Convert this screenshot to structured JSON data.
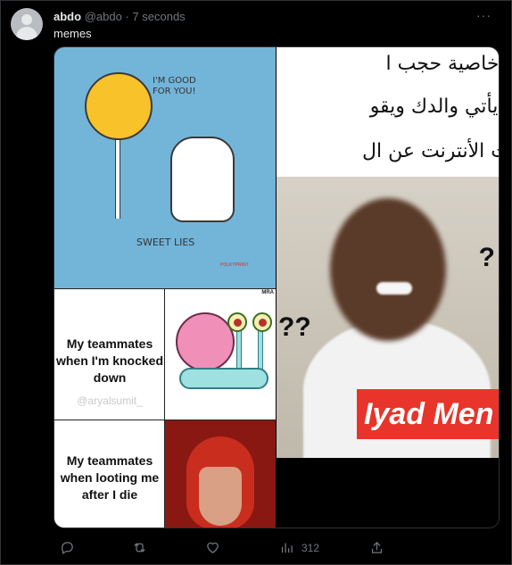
{
  "tweet": {
    "author_name": "abdo",
    "author_handle": "@abdo",
    "separator": "·",
    "time": "7 seconds",
    "more_label": "···",
    "text": "memes"
  },
  "meme_left": {
    "speech": "I'M GOOD FOR YOU!",
    "caption": "SWEET LIES",
    "credit": "POLKYPRINT",
    "panel1_caption": "My teammates when I'm knocked down",
    "panel1_watermark": "@aryalsumit_",
    "panel2_caption": "My teammates when looting me after I die",
    "corner_mark": "MRA"
  },
  "meme_right": {
    "line1": "تفعل خاصية حجب ا",
    "line2": "ية ثم يأتي والدك ويقو",
    "line3": "توقفت الأنترنت عن ال",
    "question_small": "?",
    "question_big": "??",
    "banner": "Iyad Men"
  },
  "actions": {
    "reply_icon": "reply-icon",
    "retweet_icon": "retweet-icon",
    "like_icon": "heart-icon",
    "views_icon": "views-icon",
    "views_count": "312",
    "share_icon": "share-icon"
  },
  "colors": {
    "background": "#000000",
    "text_primary": "#e7e9ea",
    "text_secondary": "#71767b",
    "banner_red": "#e8342a",
    "meme_blue": "#73b4d9"
  }
}
